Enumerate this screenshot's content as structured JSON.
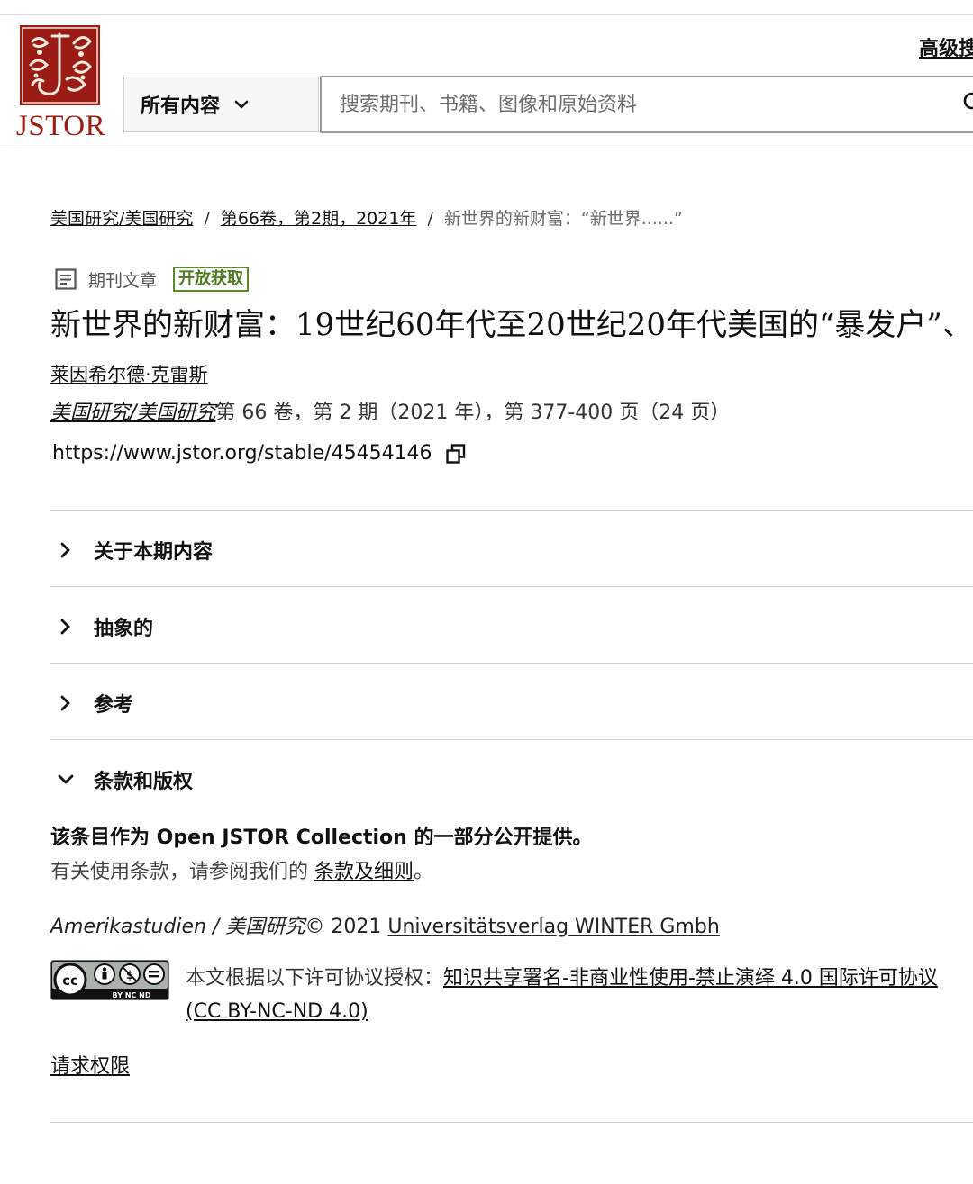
{
  "header": {
    "logo_text": "JSTOR",
    "advanced_link": "高级搜",
    "scope_label": "所有内容",
    "search_placeholder": "搜索期刊、书籍、图像和原始资料"
  },
  "breadcrumb": {
    "journal": "美国研究/美国研究",
    "issue": "第66卷，第2期，2021年",
    "current": "新世界的新财富：“新世界......”",
    "separator": "/"
  },
  "article": {
    "type_label": "期刊文章",
    "open_access_badge": "开放获取",
    "title": "新世界的新财富：19世纪60年代至20世纪20年代美国的“暴发户”、",
    "author": "莱因希尔德·克雷斯",
    "journal_name": "美国研究/美国研究",
    "citation_details": "第 66 卷，第 2 期（2021 年），第 377-400 页（24 页）",
    "stable_url": "https://www.jstor.org/stable/45454146"
  },
  "sections": [
    {
      "label": "关于本期内容",
      "expanded": false
    },
    {
      "label": "抽象的",
      "expanded": false
    },
    {
      "label": "参考",
      "expanded": false
    },
    {
      "label": "条款和版权",
      "expanded": true
    }
  ],
  "terms": {
    "open_collection": "该条目作为 Open JSTOR Collection 的一部分公开提供。",
    "usage_prefix": "有关使用条款，请参阅我们的 ",
    "usage_link": "条款及细则",
    "usage_suffix": "。",
    "copyright_journal": "Amerikastudien / 美国研究",
    "copyright_year": "© 2021 ",
    "publisher_link": "Universitätsverlag WINTER Gmbh",
    "cc_badge_label": "BY  NC  ND",
    "license_prefix": "本文根据以下许可协议授权：",
    "license_link": "知识共享署名-非商业性使用-禁止演绎 4.0 国际许可协议 (CC BY-NC-ND 4.0)",
    "request_permissions": "请求权限"
  },
  "colors": {
    "brand_red": "#9b1b15",
    "open_access_green": "#4c7a1f",
    "rule_gray": "#cfcfcf"
  }
}
